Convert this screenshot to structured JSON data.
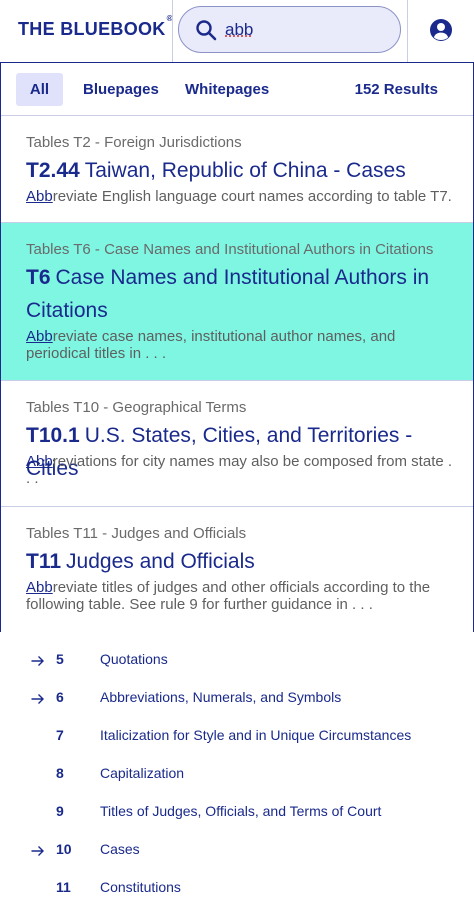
{
  "header": {
    "logo": "THE BLUEBOOK",
    "logo_mark": "®",
    "search_value": "abb"
  },
  "filters": {
    "tabs": [
      "All",
      "Bluepages",
      "Whitepages"
    ],
    "active_tab": "All",
    "result_count": "152 Results"
  },
  "results": [
    {
      "category": "Tables T2 - Foreign Jurisdictions",
      "number": "T2.44",
      "title": "Taiwan, Republic of China - Cases",
      "snippet_match": "Abb",
      "snippet_rest": "reviate English language court names according to table T7."
    },
    {
      "category": "Tables T6 - Case Names and Institutional Authors in Citations",
      "number": "T6",
      "title": "Case Names and Institutional Authors in Citations",
      "snippet_match": "Abb",
      "snippet_rest": "reviate case names, institutional author names, and periodical titles in . . ."
    },
    {
      "category": "Tables T10 - Geographical Terms",
      "number": "T10.1",
      "title": "U.S. States, Cities, and Territories - Cities",
      "snippet_match": "Abb",
      "snippet_rest": "reviations for city names may also be composed from state . . ."
    },
    {
      "category": "Tables T11 - Judges and Officials",
      "number": "T11",
      "title": "Judges and Officials",
      "snippet_match": "Abb",
      "snippet_rest": "reviate titles of judges and other officials according to the following table. See rule 9 for further guidance in . . ."
    }
  ],
  "toc": [
    {
      "number": "5",
      "label": "Quotations",
      "arrow": true
    },
    {
      "number": "6",
      "label": "Abbreviations, Numerals, and Symbols",
      "arrow": true
    },
    {
      "number": "7",
      "label": "Italicization for Style and in Unique Circumstances",
      "arrow": false
    },
    {
      "number": "8",
      "label": "Capitalization",
      "arrow": false
    },
    {
      "number": "9",
      "label": "Titles of Judges, Officials, and Terms of Court",
      "arrow": false
    },
    {
      "number": "10",
      "label": "Cases",
      "arrow": true
    },
    {
      "number": "11",
      "label": "Constitutions",
      "arrow": false
    }
  ],
  "colors": {
    "brand": "#1a2a8c",
    "highlight": "#7ef6e2",
    "active_tab_bg": "#dfe2fa"
  },
  "icons": {
    "search": "search-icon",
    "account": "account-circle-icon",
    "arrow": "arrow-right-icon"
  }
}
